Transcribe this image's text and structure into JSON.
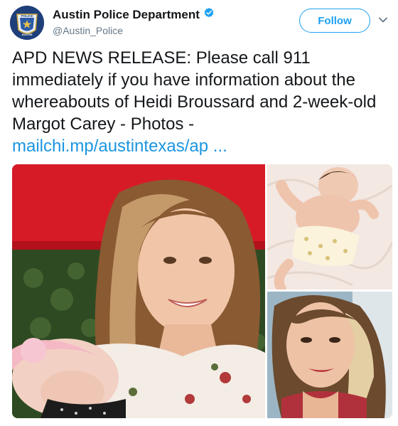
{
  "account": {
    "name": "Austin Police Department",
    "handle": "@Austin_Police",
    "verified": true,
    "avatar": {
      "icon": "police-badge-icon",
      "badge_top_text": "POLICE",
      "badge_bottom_text": "AUSTIN"
    }
  },
  "actions": {
    "follow_label": "Follow",
    "menu_icon": "chevron-down-icon"
  },
  "tweet": {
    "text": "APD NEWS RELEASE: Please call 911 immediately if you have information about the whereabouts of Heidi Broussard and 2-week-old Margot Carey - Photos - ",
    "link_text": "mailchi.mp/austintexas/ap  ...",
    "link_color": "#1b95e0"
  },
  "media": {
    "photos": [
      "woman-holding-baby-photo",
      "baby-on-blanket-photo",
      "woman-selfie-photo"
    ]
  },
  "colors": {
    "accent": "#1da1f2",
    "text": "#14171a",
    "muted": "#657786",
    "avatar_bg": "#1f3f7a"
  }
}
